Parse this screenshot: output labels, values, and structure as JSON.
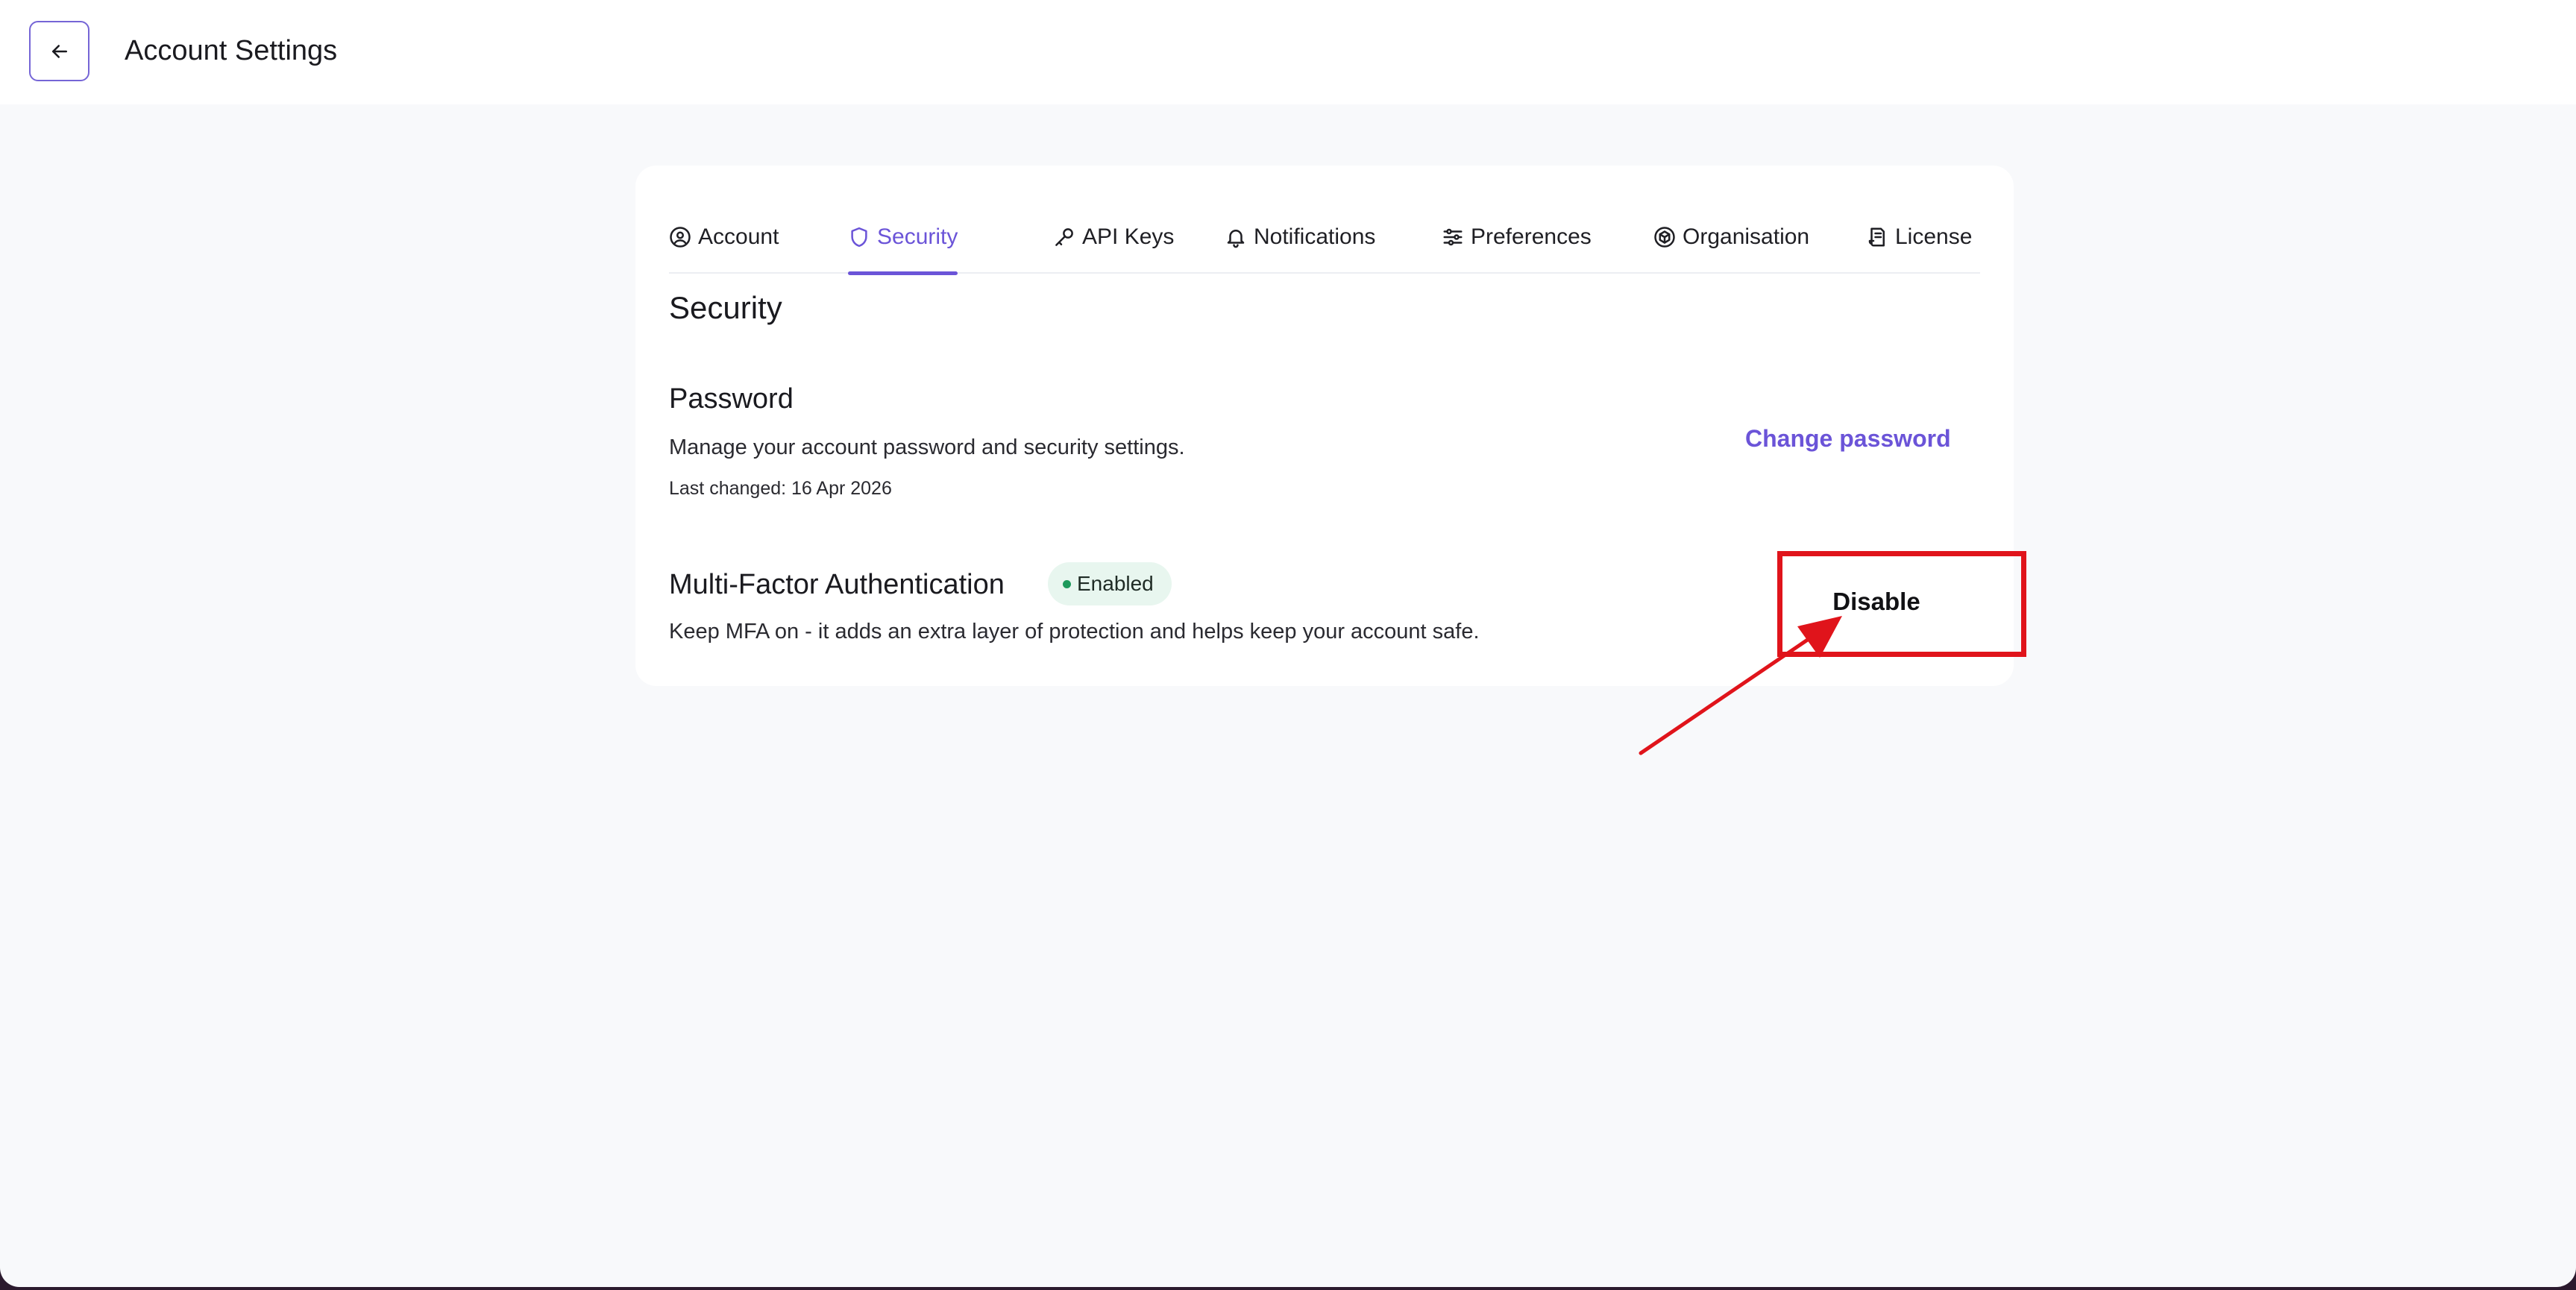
{
  "header": {
    "title": "Account Settings",
    "back_icon": "arrow-left-icon"
  },
  "tabs": [
    {
      "label": "Account",
      "icon": "user-circle-icon",
      "active": false
    },
    {
      "label": "Security",
      "icon": "shield-icon",
      "active": true
    },
    {
      "label": "API Keys",
      "icon": "key-icon",
      "active": false
    },
    {
      "label": "Notifications",
      "icon": "bell-icon",
      "active": false
    },
    {
      "label": "Preferences",
      "icon": "sliders-icon",
      "active": false
    },
    {
      "label": "Organisation",
      "icon": "cube-icon",
      "active": false
    },
    {
      "label": "License",
      "icon": "document-icon",
      "active": false
    }
  ],
  "security": {
    "title": "Security",
    "password": {
      "title": "Password",
      "description": "Manage your account password and security settings.",
      "last_changed": "Last changed: 16 Apr 2026",
      "action_label": "Change password"
    },
    "mfa": {
      "title": "Multi-Factor Authentication",
      "status": "Enabled",
      "description": "Keep MFA on - it adds an extra layer of protection and helps keep your account safe.",
      "action_label": "Disable"
    }
  },
  "colors": {
    "accent": "#6b54d8",
    "status_enabled": "#1e9a5c",
    "annotation": "#e0141b"
  }
}
